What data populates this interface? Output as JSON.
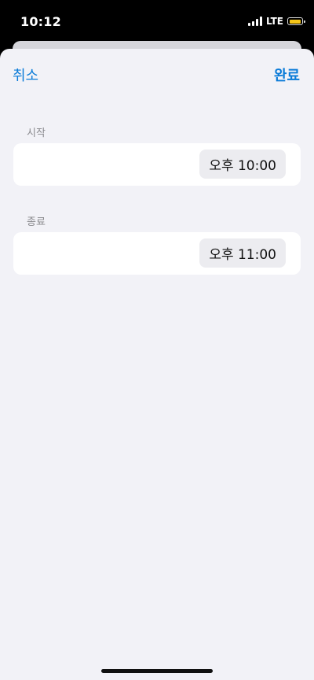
{
  "status_bar": {
    "time": "10:12",
    "network": "LTE",
    "battery_color": "#f5c518"
  },
  "nav": {
    "cancel_label": "취소",
    "done_label": "완료"
  },
  "start": {
    "label": "시작",
    "time": "오후 10:00"
  },
  "end": {
    "label": "종료",
    "time": "오후 11:00"
  },
  "colors": {
    "accent": "#0a7bd8",
    "sheet_background": "#f2f2f7",
    "card_background": "#ffffff",
    "pill_background": "#ececf0"
  },
  "icons": [
    "signal-icon",
    "battery-icon"
  ]
}
